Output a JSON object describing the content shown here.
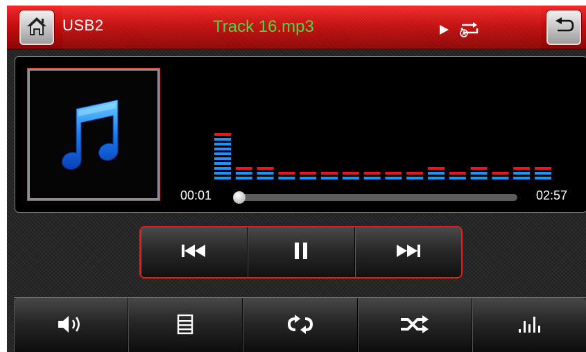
{
  "header": {
    "source": "USB2",
    "track": "Track 16.mp3"
  },
  "icons": {
    "home": "home-icon",
    "back": "back-arrow-icon",
    "play_state": "play-icon",
    "repeat_mode": "repeat-all-icon",
    "album_art": "music-note-icon"
  },
  "playback": {
    "elapsed": "00:01",
    "total": "02:57",
    "progress": 0.006
  },
  "spectrum": {
    "levels": [
      9,
      2,
      2,
      1,
      1,
      1,
      1,
      1,
      1,
      1,
      2,
      1,
      2,
      1,
      2,
      2
    ],
    "colors": {
      "bar": "#1e90ff",
      "peak": "#e8171e"
    }
  },
  "transport": {
    "buttons": [
      "previous-track",
      "pause",
      "next-track"
    ]
  },
  "bottom_bar": {
    "buttons": [
      "volume",
      "playlist",
      "repeat",
      "shuffle",
      "equalizer"
    ]
  },
  "colors": {
    "header_red": "#d01616",
    "track_title": "#46d643",
    "accent_border": "#e0201b"
  }
}
